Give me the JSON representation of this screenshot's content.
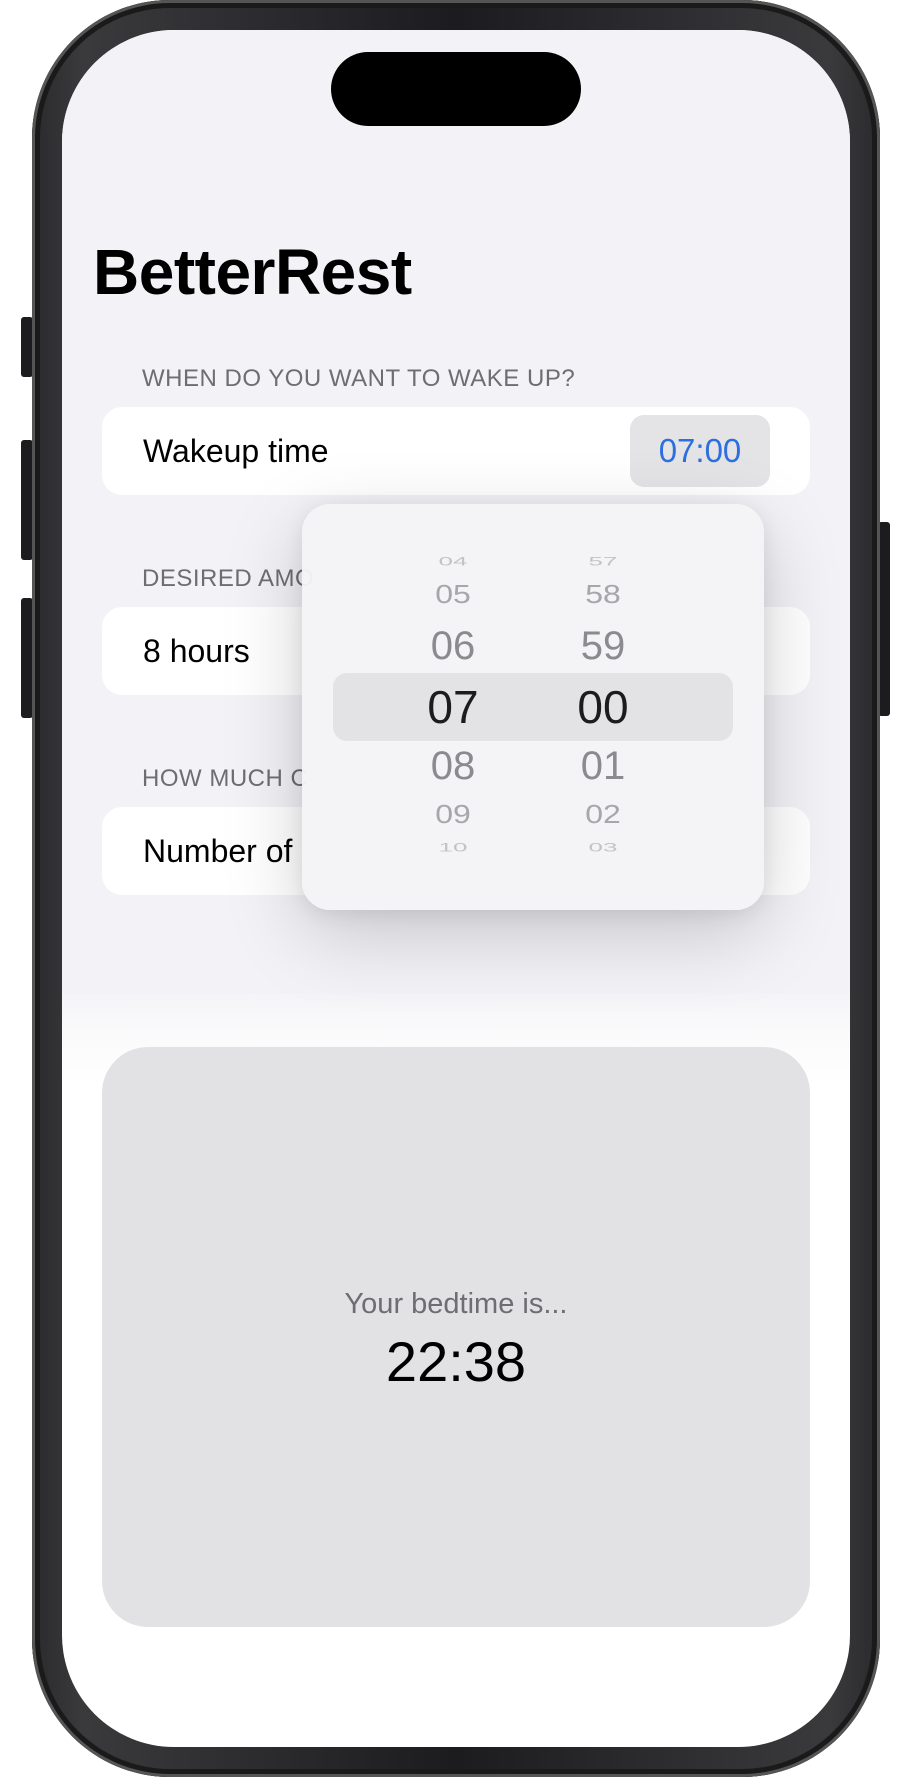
{
  "app": {
    "title": "BetterRest"
  },
  "sections": {
    "wake": {
      "header": "WHEN DO YOU WANT TO WAKE UP?",
      "row_label": "Wakeup time",
      "value": "07:00"
    },
    "sleep": {
      "header": "DESIRED AMO",
      "row_label": "8 hours"
    },
    "coffee": {
      "header": "HOW MUCH C",
      "row_label": "Number of"
    }
  },
  "time_picker": {
    "hours": [
      "04",
      "05",
      "06",
      "07",
      "08",
      "09",
      "10"
    ],
    "minutes": [
      "57",
      "58",
      "59",
      "00",
      "01",
      "02",
      "03"
    ],
    "selected_hour": "07",
    "selected_minute": "00"
  },
  "result": {
    "caption": "Your bedtime is...",
    "time": "22:38"
  },
  "colors": {
    "accent": "#2c6fe0",
    "grouped_background": "#f2f2f7",
    "result_card": "#e2e2e5"
  }
}
